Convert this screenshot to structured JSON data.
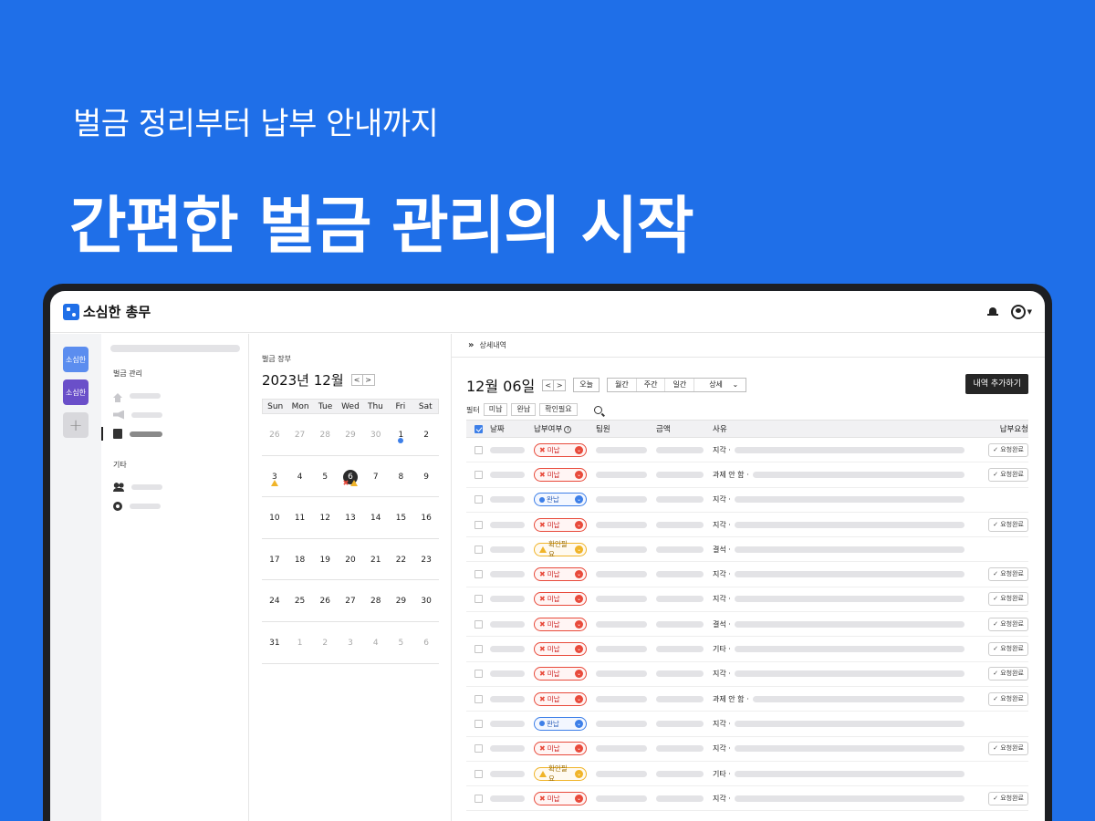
{
  "hero": {
    "subtitle": "벌금 정리부터 납부 안내까지",
    "title": "간편한 벌금 관리의 시작"
  },
  "app": {
    "brand": "소심한 총무",
    "accent": "#1f6fe8"
  },
  "rail": {
    "workspaces": [
      "소심한",
      "소심한"
    ],
    "add_label": "+"
  },
  "menu": {
    "section1": "벌금 관리",
    "section2": "기타",
    "icons": [
      "home-icon",
      "megaphone-icon",
      "document-icon",
      "people-icon",
      "gear-icon"
    ]
  },
  "calendar": {
    "label": "벌금 장부",
    "month": "2023년 12월",
    "prev": "<",
    "next": ">",
    "dow": [
      "Sun",
      "Mon",
      "Tue",
      "Wed",
      "Thu",
      "Fri",
      "Sat"
    ],
    "weeks": [
      [
        {
          "n": "26",
          "m": true
        },
        {
          "n": "27",
          "m": true
        },
        {
          "n": "28",
          "m": true
        },
        {
          "n": "29",
          "m": true
        },
        {
          "n": "30",
          "m": true
        },
        {
          "n": "1",
          "marks": [
            "dot"
          ]
        },
        {
          "n": "2"
        }
      ],
      [
        {
          "n": "3",
          "marks": [
            "tri"
          ]
        },
        {
          "n": "4"
        },
        {
          "n": "5"
        },
        {
          "n": "6",
          "today": true,
          "marks": [
            "x",
            "tri"
          ]
        },
        {
          "n": "7"
        },
        {
          "n": "8"
        },
        {
          "n": "9"
        }
      ],
      [
        {
          "n": "10"
        },
        {
          "n": "11"
        },
        {
          "n": "12"
        },
        {
          "n": "13"
        },
        {
          "n": "14"
        },
        {
          "n": "15"
        },
        {
          "n": "16"
        }
      ],
      [
        {
          "n": "17"
        },
        {
          "n": "18"
        },
        {
          "n": "19"
        },
        {
          "n": "20"
        },
        {
          "n": "21"
        },
        {
          "n": "22"
        },
        {
          "n": "23"
        }
      ],
      [
        {
          "n": "24"
        },
        {
          "n": "25"
        },
        {
          "n": "26"
        },
        {
          "n": "27"
        },
        {
          "n": "28"
        },
        {
          "n": "29"
        },
        {
          "n": "30"
        }
      ],
      [
        {
          "n": "31"
        },
        {
          "n": "1",
          "m": true
        },
        {
          "n": "2",
          "m": true
        },
        {
          "n": "3",
          "m": true
        },
        {
          "n": "4",
          "m": true
        },
        {
          "n": "5",
          "m": true
        },
        {
          "n": "6",
          "m": true
        }
      ]
    ]
  },
  "detail": {
    "breadcrumb": "상세내역",
    "date": "12월 06일",
    "prev": "<",
    "next": ">",
    "today": "오늘",
    "views": [
      "월간",
      "주간",
      "일간"
    ],
    "detail_select": "상세",
    "add_button": "내역 추가하기",
    "filter_label": "필터",
    "filters": [
      "미납",
      "완납",
      "확인필요"
    ],
    "columns": {
      "date": "날짜",
      "status": "납부여부",
      "member": "팀원",
      "amount": "금액",
      "reason": "사유",
      "request": "납부요청"
    },
    "request_done": "요청완료",
    "status_labels": {
      "unpaid": "미납",
      "paid": "완납",
      "check": "확인필요"
    },
    "rows": [
      {
        "status": "unpaid",
        "reason": "지각 ·",
        "req": true
      },
      {
        "status": "unpaid",
        "reason": "과제 안 함 ·",
        "req": true
      },
      {
        "status": "paid",
        "reason": "지각 ·",
        "req": false
      },
      {
        "status": "unpaid",
        "reason": "지각 ·",
        "req": true
      },
      {
        "status": "check",
        "reason": "결석 ·",
        "req": false
      },
      {
        "status": "unpaid",
        "reason": "지각 ·",
        "req": true
      },
      {
        "status": "unpaid",
        "reason": "지각 ·",
        "req": true
      },
      {
        "status": "unpaid",
        "reason": "결석 ·",
        "req": true
      },
      {
        "status": "unpaid",
        "reason": "기타 ·",
        "req": true
      },
      {
        "status": "unpaid",
        "reason": "지각 ·",
        "req": true
      },
      {
        "status": "unpaid",
        "reason": "과제 안 함 ·",
        "req": true
      },
      {
        "status": "paid",
        "reason": "지각 ·",
        "req": false
      },
      {
        "status": "unpaid",
        "reason": "지각 ·",
        "req": true
      },
      {
        "status": "check",
        "reason": "기타 ·",
        "req": false
      },
      {
        "status": "unpaid",
        "reason": "지각 ·",
        "req": true
      }
    ]
  }
}
